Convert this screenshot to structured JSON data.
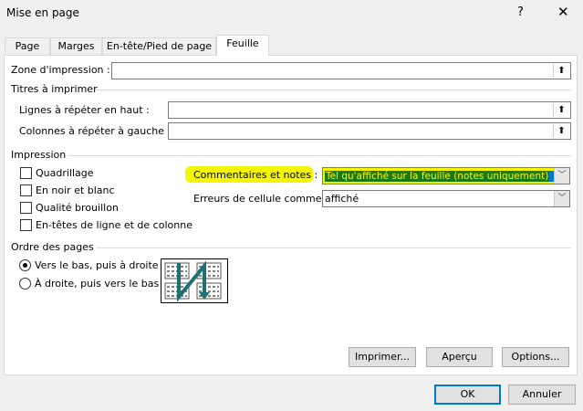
{
  "window": {
    "title": "Mise en page",
    "help": "?",
    "close": "✕"
  },
  "tabs": [
    {
      "label": "Page"
    },
    {
      "label": "Marges"
    },
    {
      "label": "En-tête/Pied de page"
    },
    {
      "label": "Feuille"
    }
  ],
  "print_area": {
    "label": "Zone d'impression :",
    "value": ""
  },
  "print_titles": {
    "heading": "Titres à imprimer",
    "rows_label": "Lignes à répéter en haut :",
    "cols_label": "Colonnes à répéter à gauche :"
  },
  "print": {
    "heading": "Impression",
    "checkboxes": [
      {
        "label": "Quadrillage",
        "checked": false
      },
      {
        "label": "En noir et blanc",
        "checked": false
      },
      {
        "label": "Qualité brouillon",
        "checked": false
      },
      {
        "label": "En-têtes de ligne et de colonne",
        "checked": false
      }
    ],
    "comments_label": "Commentaires et notes :",
    "comments_value": "Tel qu'affiché sur la feuille (notes uniquement)",
    "errors_label": "Erreurs de cellule comme :",
    "errors_value": "affiché"
  },
  "page_order": {
    "heading": "Ordre des pages",
    "options": [
      {
        "label": "Vers le bas, puis à droite",
        "selected": true
      },
      {
        "label": "À droite, puis vers le bas",
        "selected": false
      }
    ]
  },
  "buttons": {
    "print": "Imprimer...",
    "preview": "Aperçu",
    "options": "Options...",
    "ok": "OK",
    "cancel": "Annuler"
  },
  "colors": {
    "highlight": "#f5f500",
    "selection": "#1a7a1a",
    "accent": "#0078d7"
  }
}
